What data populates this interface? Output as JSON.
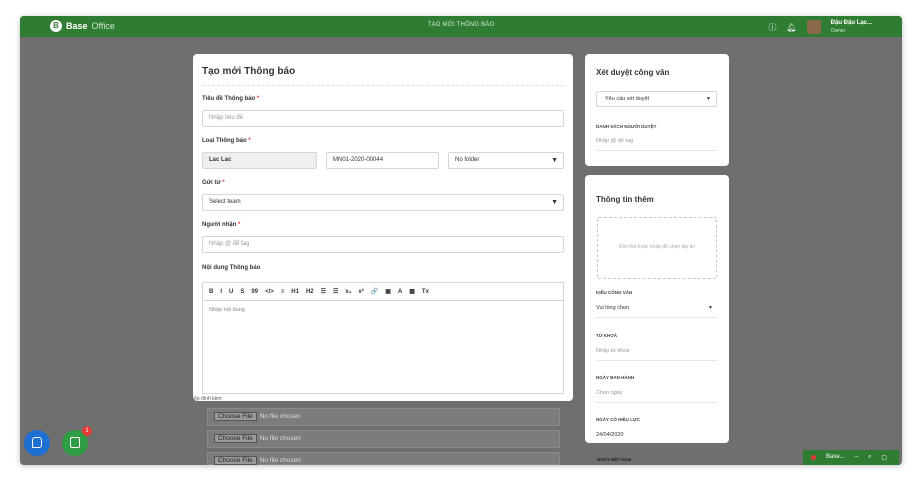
{
  "topbar": {
    "logo_bold": "Base",
    "logo_light": "Office",
    "title": "TẠO MỚI THÔNG BÁO",
    "help_icon": "help-icon",
    "bell_icon": "bell-icon",
    "user_name": "Đậu Đậu Lạc...",
    "user_role": "Owner"
  },
  "form": {
    "title": "Tạo mới Thông báo",
    "subject_label": "Tiêu đề Thông báo",
    "subject_placeholder": "Nhập tiêu đề",
    "type_label": "Loại Thông báo",
    "type_value": "Lac Lac",
    "code_value": "MN01-2020-00044",
    "folder_value": "No folder",
    "from_label": "Gửi từ",
    "from_value": "Select team",
    "to_label": "Người nhận",
    "to_placeholder": "Nhập @ để tag",
    "content_label": "Nội dung Thông báo",
    "toolbar": [
      "B",
      "I",
      "U",
      "S",
      "99",
      "</>",
      "≡",
      "H1",
      "H2",
      "☰",
      "☰",
      "x₂",
      "x²",
      "🔗",
      "▣",
      "A",
      "▦",
      "Tx"
    ],
    "content_placeholder": "Nhập nội dung",
    "required_mark": "*"
  },
  "attachments": {
    "label": "Tệp đính kèm",
    "button": "Choose File",
    "status": "No file chosen"
  },
  "approval": {
    "title": "Xét duyệt công văn",
    "select_value": "Yêu cầu xét duyệt",
    "approvers_label": "DANH SÁCH NGƯỜI DUYỆT",
    "approvers_placeholder": "Nhập @ để tag"
  },
  "extra": {
    "title": "Thông tin thêm",
    "drop_text": "Kéo thả hoặc nhấp để chọn tập tin",
    "doc_type_label": "KIỂU CÔNG VĂN",
    "doc_type_value": "Vui lòng chọn",
    "keyword_label": "TỪ KHOÁ",
    "keyword_placeholder": "Nhập từ khoá",
    "issue_label": "NGÀY BAN HÀNH",
    "issue_placeholder": "Chọn ngày",
    "effective_label": "NGÀY CÓ HIỆU LỰC",
    "effective_value": "24/04/2020",
    "expire_label": "NGÀY HẾT HẠN"
  },
  "fab": {
    "badge": "1"
  },
  "chat": {
    "label": "Base..."
  },
  "colors": {
    "brand": "#2f7d32",
    "required": "#e53935",
    "fab_blue": "#1d6fd1",
    "fab_green": "#2f9d44"
  }
}
